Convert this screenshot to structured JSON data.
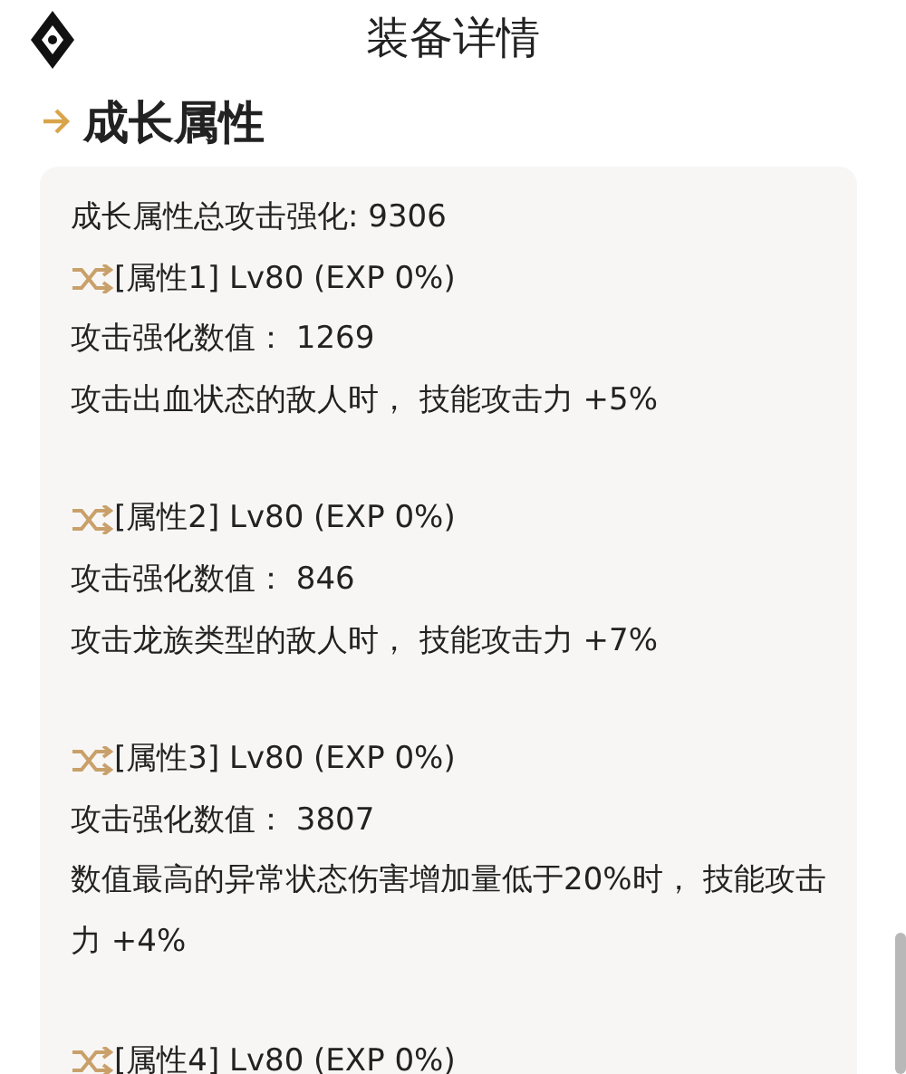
{
  "header": {
    "title": "装备详情"
  },
  "section": {
    "title": "成长属性"
  },
  "card": {
    "summary": "成长属性总攻击强化: 9306",
    "attributes": [
      {
        "header": "[属性1] Lv80 (EXP 0%)",
        "value": "攻击强化数值： 1269",
        "effect": "攻击出血状态的敌人时， 技能攻击力 +5%"
      },
      {
        "header": "[属性2] Lv80 (EXP 0%)",
        "value": "攻击强化数值： 846",
        "effect": "攻击龙族类型的敌人时， 技能攻击力 +7%"
      },
      {
        "header": "[属性3] Lv80 (EXP 0%)",
        "value": "攻击强化数值： 3807",
        "effect": "数值最高的异常状态伤害增加量低于20%时， 技能攻击力 +4%"
      },
      {
        "header": "[属性4] Lv80 (EXP 0%)"
      }
    ]
  }
}
